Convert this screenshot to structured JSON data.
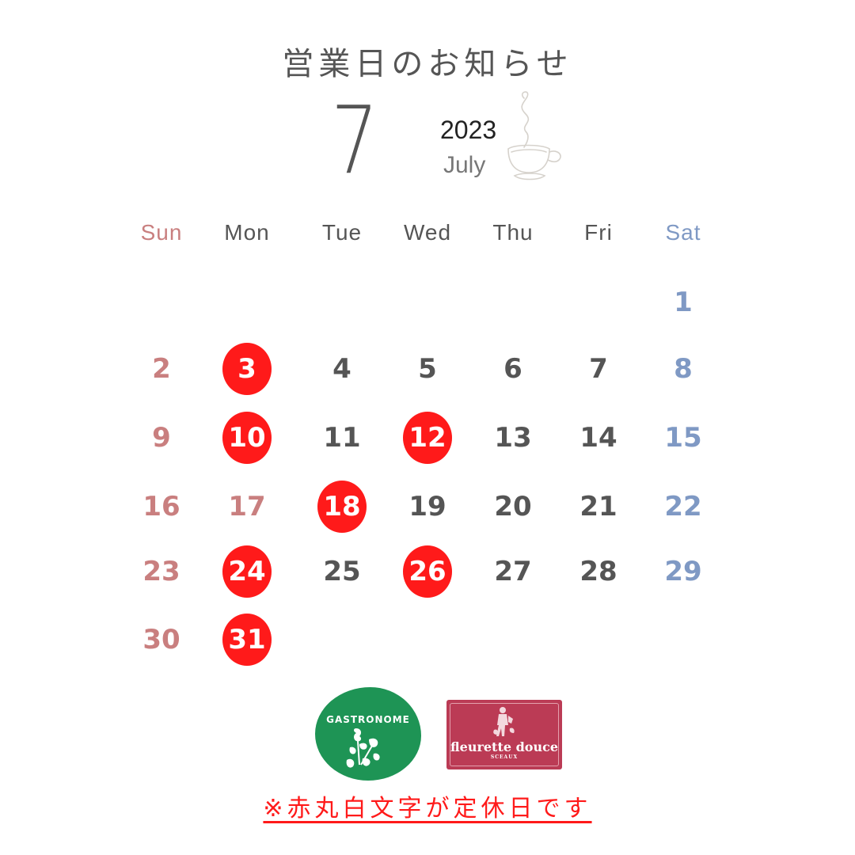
{
  "header": {
    "title": "営業日のお知らせ",
    "month_number": "7",
    "year": "2023",
    "month_name": "July",
    "decoration_icon": "coffee-cup-icon"
  },
  "colors": {
    "sunday_holiday": "#c97f7f",
    "weekday": "#555555",
    "saturday": "#7f99c4",
    "closed_bg": "#ff1a1a",
    "closed_text": "#ffffff",
    "gastronome_green": "#1e9455",
    "fleurette_red": "#bb3b55"
  },
  "calendar": {
    "weekdays": [
      {
        "label": "Sun",
        "type": "sun"
      },
      {
        "label": "Mon",
        "type": "weekday"
      },
      {
        "label": "Tue",
        "type": "weekday"
      },
      {
        "label": "Wed",
        "type": "weekday"
      },
      {
        "label": "Thu",
        "type": "weekday"
      },
      {
        "label": "Fri",
        "type": "weekday"
      },
      {
        "label": "Sat",
        "type": "sat"
      }
    ],
    "first_weekday_index": 6,
    "days_in_month": 31,
    "holidays": [
      17
    ],
    "closed_days": [
      3,
      10,
      12,
      18,
      24,
      26,
      31
    ]
  },
  "logos": {
    "gastronome": "GASTRONOME",
    "fleurette_name": "fleurette douce",
    "fleurette_sub": "SCEAUX"
  },
  "footer": {
    "note": "※赤丸白文字が定休日です"
  }
}
